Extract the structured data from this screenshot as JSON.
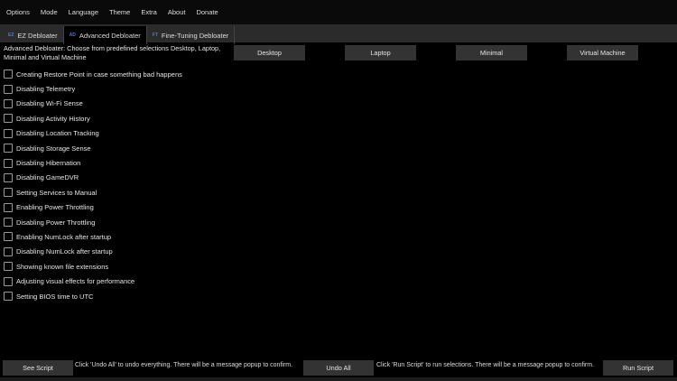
{
  "menu": [
    "Options",
    "Mode",
    "Language",
    "Theme",
    "Extra",
    "About",
    "Donate"
  ],
  "tabs": [
    {
      "icon": "EZ",
      "label": "EZ Debloater"
    },
    {
      "icon": "AD",
      "label": "Advanced Debloater"
    },
    {
      "icon": "FT",
      "label": "Fine-Tuning Debloater"
    }
  ],
  "description": "Advanced Debloater: Choose from predefined selections Desktop, Laptop, Minimal and Virtual Machine",
  "presets": [
    "Desktop",
    "Laptop",
    "Minimal",
    "Virtual Machine"
  ],
  "options": [
    "Creating Restore Point in case something bad happens",
    "Disabling Telemetry",
    "Disabling Wi-Fi Sense",
    "Disabling Activity History",
    "Disabling Location Tracking",
    "Disabling Storage Sense",
    "Disabling Hibernation",
    "Disabling GameDVR",
    "Setting Services to Manual",
    "Enabling Power Throttling",
    "Disabling Power Throttling",
    "Enabling NumLock after startup",
    "Disabling NumLock after startup",
    "Showing known file extensions",
    "Adjusting visual effects for performance",
    "Setting BIOS time to UTC"
  ],
  "bottom": {
    "see_script": "See Script",
    "undo_hint": "Click 'Undo All' to undo everything. There will be a message popup to confirm.",
    "undo_all": "Undo All",
    "run_hint": "Click 'Run Script' to run selections. There will be a message popup to confirm.",
    "run_script": "Run Script"
  }
}
